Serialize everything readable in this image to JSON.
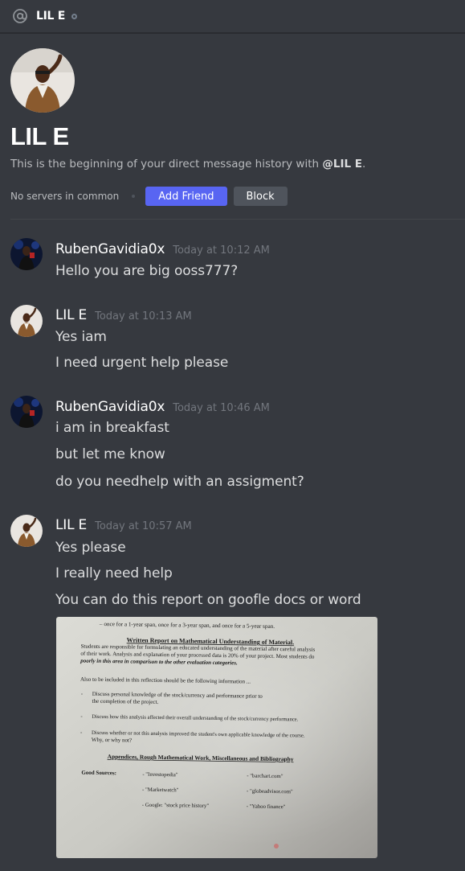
{
  "header": {
    "title": "LIL E"
  },
  "intro": {
    "title": "LIL E",
    "description_prefix": "This is the beginning of your direct message history with ",
    "handle": "@LIL E",
    "description_suffix": ".",
    "no_servers": "No servers in common",
    "add_friend_label": "Add Friend",
    "block_label": "Block"
  },
  "messages": [
    {
      "username": "RubenGavidia0x",
      "timestamp": "Today at 10:12 AM",
      "lines": [
        "Hello you are big ooss777?"
      ]
    },
    {
      "username": "LIL E",
      "timestamp": "Today at 10:13 AM",
      "lines": [
        "Yes iam",
        "I need urgent help please"
      ]
    },
    {
      "username": "RubenGavidia0x",
      "timestamp": "Today at 10:46 AM",
      "lines": [
        "i am in breakfast",
        "but let me know",
        "do you needhelp with an assigment?"
      ]
    },
    {
      "username": "LIL E",
      "timestamp": "Today at 10:57 AM",
      "lines": [
        "Yes please",
        "I really need help",
        "You can do this report on goofle docs or word"
      ]
    }
  ],
  "attachment": {
    "top_line": "– once for a 1-year span, once for a 3-year span, and once for a 5-year span.",
    "heading": "Written Report on Mathematical Understanding of Material.",
    "para1": "Students are responsible for formulating an educated understanding of the material after careful analysis",
    "para2": "of their work. Analysis and explanation of your processed data is 20% of your project. Most students do",
    "para3": "poorly in this area in comparison to the other evaluation categories.",
    "also": "Also to be included in this reflection should be the following information ...",
    "bullet1a": "Discuss personal knowledge of the stock/currency and performance prior to",
    "bullet1b": "the completion of the project.",
    "bullet2": "Discuss how this analysis affected their overall understanding of the stock/currency performance.",
    "bullet3a": "Discuss whether or not this analysis improved the student's own applicable knowledge of the course.",
    "bullet3b": "Why, or why not?",
    "appendices": "Appendices, Rough Mathematical Work, Miscellaneous and Bibliography",
    "good_sources": "Good Sources:",
    "src1": "- \"Investopedia\"",
    "src2": "- \"barchart.com\"",
    "src3": "- \"Marketwatch\"",
    "src4": "- \"globeadvisor.com\"",
    "src5": "- Google: \"stock price history\"",
    "src6": "- \"Yahoo finance\""
  },
  "colors": {
    "background": "#36393f",
    "blurple": "#5865f2",
    "block_button": "#4f545c",
    "timestamp": "#72767d"
  },
  "icons": {
    "header": "at-sign-icon",
    "status": "offline-status-icon"
  }
}
